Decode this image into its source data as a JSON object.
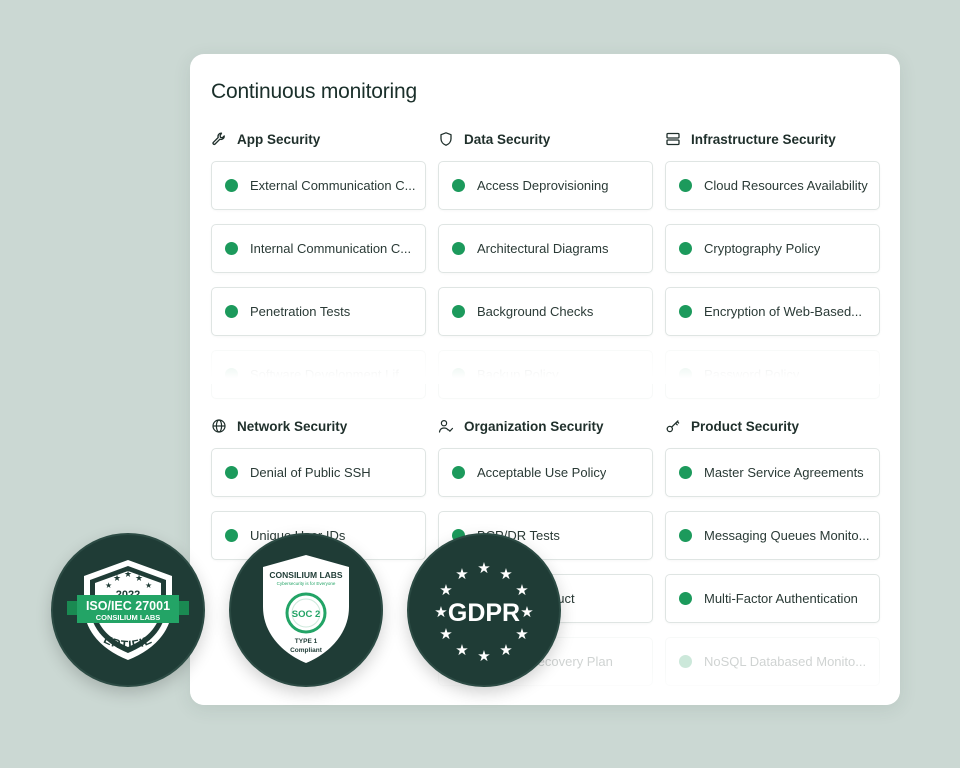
{
  "title": "Continuous monitoring",
  "colors": {
    "status_ok": "#1c9a5c",
    "badge_bg": "#1f3c36",
    "badge_green": "#23a466"
  },
  "sections": [
    {
      "label": "App Security",
      "icon": "wrench-icon",
      "items": [
        "External Communication C...",
        "Internal Communication C...",
        "Penetration Tests",
        "Software Development Lif..."
      ]
    },
    {
      "label": "Data Security",
      "icon": "shield-icon",
      "items": [
        "Access Deprovisioning",
        "Architectural Diagrams",
        "Background Checks",
        "Backup Policy"
      ]
    },
    {
      "label": "Infrastructure Security",
      "icon": "server-icon",
      "items": [
        "Cloud Resources Availability",
        "Cryptography Policy",
        "Encryption of Web-Based...",
        "Password Policy"
      ]
    },
    {
      "label": "Network Security",
      "icon": "globe-icon",
      "items": [
        "Denial of Public SSH",
        "Unique User IDs"
      ]
    },
    {
      "label": "Organization Security",
      "icon": "user-check-icon",
      "items": [
        "Acceptable Use Policy",
        "BCP/DR Tests",
        "Code of Conduct",
        "Disaster Recovery Plan"
      ]
    },
    {
      "label": "Product Security",
      "icon": "key-icon",
      "items": [
        "Master Service Agreements",
        "Messaging Queues Monito...",
        "Multi-Factor Authentication",
        "NoSQL Databased Monito..."
      ]
    }
  ],
  "badges": {
    "iso": {
      "year": "2022",
      "line1": "ISO/IEC 27001",
      "line2": "CONSILIUM LABS",
      "line3": "CERTIFIED"
    },
    "soc": {
      "brand": "CONSILIUM LABS",
      "tagline": "Cybersecurity is for Everyone",
      "label": "SOC 2",
      "type": "TYPE 1",
      "status": "Compliant"
    },
    "gdpr": {
      "label": "GDPR"
    }
  }
}
